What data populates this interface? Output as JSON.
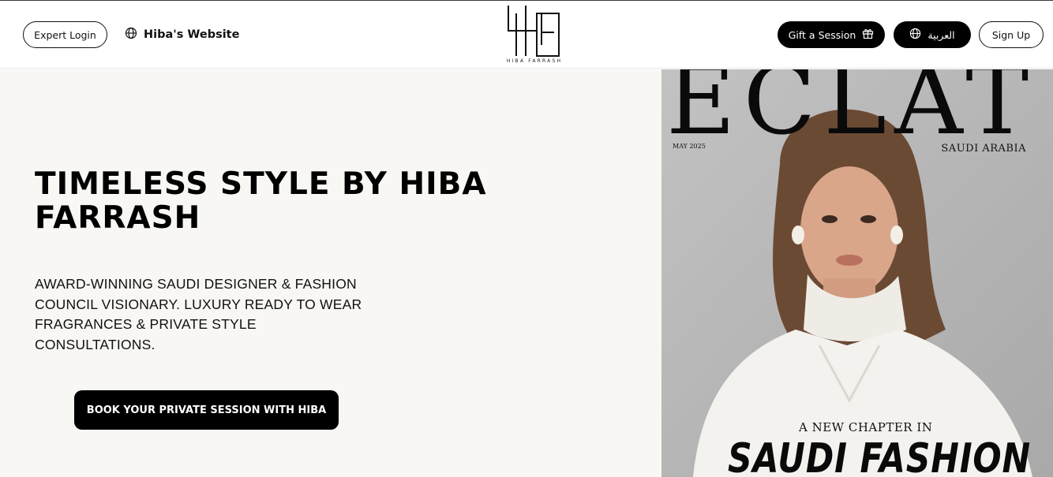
{
  "header": {
    "expert_login": "Expert Login",
    "site_link": "Hiba's Website",
    "logo_wordmark": "HIBA FARRASH",
    "gift_label": "Gift a Session",
    "language_label": "العربية",
    "signup_label": "Sign Up"
  },
  "hero": {
    "title": "TIMELESS STYLE BY HIBA FARRASH",
    "subtitle": "AWARD-WINNING SAUDI DESIGNER & FASHION COUNCIL VISIONARY. LUXURY READY TO WEAR FRAGRANCES & PRIVATE STYLE CONSULTATIONS.",
    "cta_label": "BOOK YOUR PRIVATE SESSION WITH HIBA"
  },
  "cover": {
    "magazine": "ECLAT",
    "date": "MAY 2025",
    "region": "SAUDI ARABIA",
    "tagline": "A NEW CHAPTER IN",
    "headline": "SAUDI FASHION"
  },
  "colors": {
    "accent": "#000000",
    "hero_bg": "#f8f7f4",
    "cover_bg": "#b6b6b6"
  },
  "icons": [
    "globe-icon",
    "gift-icon",
    "logo-monogram-icon"
  ]
}
